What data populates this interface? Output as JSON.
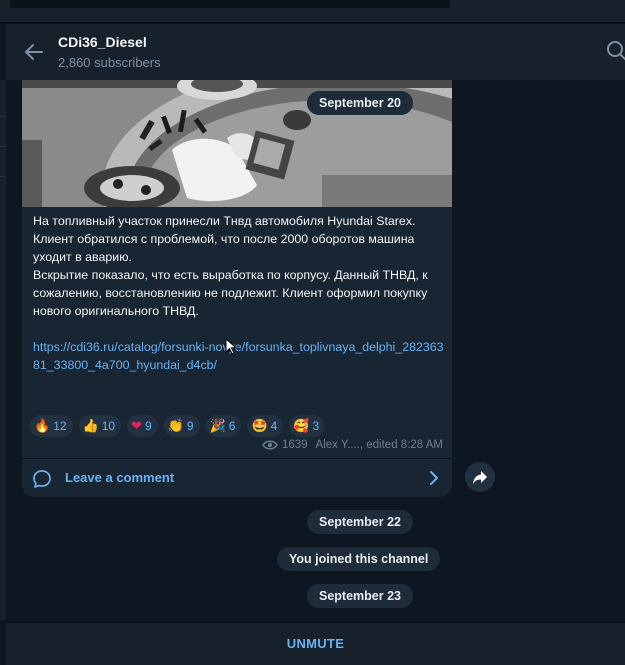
{
  "colors": {
    "background": "#0e1621",
    "panel": "#17212b",
    "bubble": "#182533",
    "accent": "#6ab2f2",
    "muted": "#7f91a4"
  },
  "header": {
    "title": "CDi36_Diesel",
    "subtitle": "2,860 subscribers",
    "back_icon": "arrow-left-icon",
    "search_icon": "search-icon"
  },
  "message": {
    "photo_date": "September 20",
    "paragraphs": [
      "На топливный участок принесли Тнвд автомобиля Hyundai Starex.",
      "Клиент обратился с проблемой, что после 2000 оборотов машина уходит в аварию.",
      "Вскрытие показало, что есть выработка по корпусу. Данный ТНВД, к сожалению, восстановлению не подлежит. Клиент оформил покупку нового оригинального ТНВД."
    ],
    "link": "https://cdi36.ru/catalog/forsunki-novye/forsunka_toplivnaya_delphi_28236381_33800_4a700_hyundai_d4cb/",
    "reactions": [
      {
        "emoji": "🔥",
        "count": "12"
      },
      {
        "emoji": "👍",
        "count": "10"
      },
      {
        "emoji": "❤",
        "count": "9"
      },
      {
        "emoji": "👏",
        "count": "9"
      },
      {
        "emoji": "🎉",
        "count": "6"
      },
      {
        "emoji": "🤩",
        "count": "4"
      },
      {
        "emoji": "🥰",
        "count": "3"
      }
    ],
    "views": "1639",
    "author_time": "Alex Y...., edited 8:28 AM",
    "comment_label": "Leave a comment"
  },
  "service": {
    "date1": "September 22",
    "joined": "You joined this channel",
    "date2": "September 23"
  },
  "footer": {
    "unmute": "UNMUTE"
  }
}
